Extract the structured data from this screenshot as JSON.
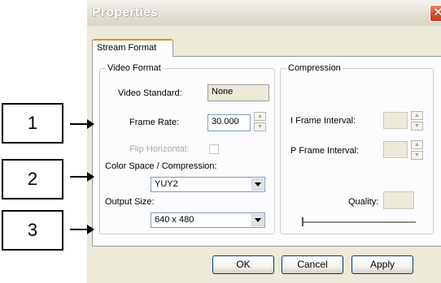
{
  "window": {
    "title": "Properties",
    "close_glyph": "✕"
  },
  "tabs": [
    {
      "label": "Stream Format",
      "selected": true
    }
  ],
  "video_format": {
    "legend": "Video Format",
    "video_standard_label": "Video Standard:",
    "video_standard_value": "None",
    "frame_rate_label": "Frame Rate:",
    "frame_rate_value": "30.000",
    "flip_horizontal_label": "Flip Horizontal:",
    "flip_horizontal_checked": false,
    "color_space_label": "Color Space / Compression:",
    "color_space_value": "YUY2",
    "output_size_label": "Output Size:",
    "output_size_value": "640 x 480"
  },
  "compression": {
    "legend": "Compression",
    "i_frame_label": "I Frame Interval:",
    "i_frame_value": "",
    "p_frame_label": "P Frame Interval:",
    "p_frame_value": "",
    "quality_label": "Quality:",
    "quality_value": "",
    "quality_slider_level": 0
  },
  "buttons": {
    "ok": "OK",
    "cancel": "Cancel",
    "apply": "Apply"
  },
  "annotations": [
    {
      "label": "1",
      "points_to": "Frame Rate"
    },
    {
      "label": "2",
      "points_to": "Color Space / Compression"
    },
    {
      "label": "3",
      "points_to": "Output Size"
    }
  ],
  "icons": {
    "spin_up": "▲",
    "spin_down": "▼"
  }
}
